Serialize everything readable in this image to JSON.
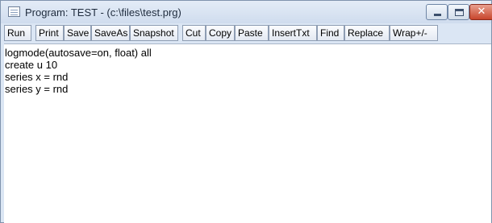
{
  "window": {
    "title": "Program: TEST - (c:\\files\\test.prg)",
    "close_glyph": "✕",
    "accent_color": "#c8452c"
  },
  "toolbar": {
    "buttons": [
      "Run",
      "Print",
      "Save",
      "SaveAs",
      "Snapshot",
      "Cut",
      "Copy",
      "Paste",
      "InsertTxt",
      "Find",
      "Replace",
      "Wrap+/-"
    ]
  },
  "editor": {
    "lines": [
      "logmode(autosave=on, float) all",
      "create u 10",
      "series x = rnd",
      "series y = rnd"
    ]
  }
}
